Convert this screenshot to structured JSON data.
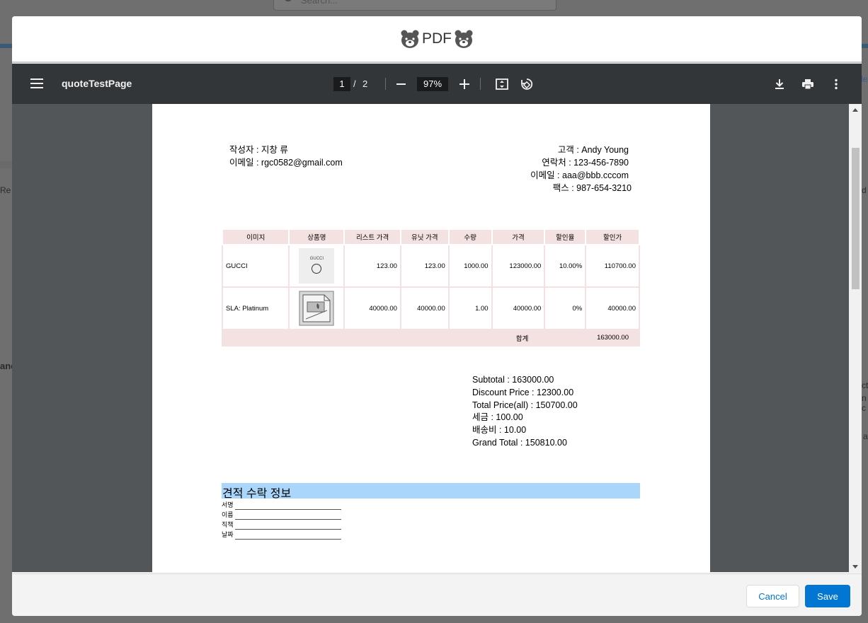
{
  "background": {
    "search_placeholder": "Search...",
    "left_fragment_1": "Re",
    "left_fragment_2": "anc",
    "right_fragment_1": "ct",
    "right_fragment_2": "n c",
    "right_fragment_3": "a",
    "right_fragment_4": "d",
    "right_fragment_5": "le"
  },
  "header": {
    "logo_text": "PDF",
    "logo_icon": "bear-icon"
  },
  "viewer": {
    "title": "quoteTestPage",
    "current_page": "1",
    "page_separator": "/",
    "total_pages": "2",
    "zoom": "97%",
    "icons": [
      "menu-icon",
      "zoom-out-icon",
      "zoom-in-icon",
      "fit-page-icon",
      "rotate-icon",
      "download-icon",
      "print-icon",
      "more-options-icon"
    ]
  },
  "document": {
    "author_line": "작성자 : 지창 류",
    "author_email": "이메일 : rgc0582@gmail.com",
    "customer_line": "고객 : Andy Young",
    "contact_line": "연락처 : 123-456-7890",
    "customer_email": "이메일 : aaa@bbb.cccom",
    "fax_line": "팩스 : 987-654-3210",
    "table": {
      "headers": [
        "이미지",
        "상품명",
        "리스트 가격",
        "유닛 가격",
        "수량",
        "가격",
        "할인율",
        "할인가"
      ],
      "rows": [
        {
          "name": "GUCCI",
          "image_label": "GUCCI",
          "list_price": "123.00",
          "unit_price": "123.00",
          "quantity": "1000.00",
          "price": "123000.00",
          "discount_rate": "10.00%",
          "discounted": "110700.00"
        },
        {
          "name": "SLA: Platinum",
          "image_label": "",
          "list_price": "40000.00",
          "unit_price": "40000.00",
          "quantity": "1.00",
          "price": "40000.00",
          "discount_rate": "0%",
          "discounted": "40000.00"
        }
      ],
      "sum_label": "합계",
      "sum_value": "163000.00"
    },
    "totals": {
      "subtotal": "Subtotal : 163000.00",
      "discount": "Discount Price : 12300.00",
      "total_price": "Total Price(all) : 150700.00",
      "tax": "세금 : 100.00",
      "shipping": "배송비 : 10.00",
      "grand_total": "Grand Total : 150810.00"
    },
    "accept": {
      "title": "견적 수락 정보",
      "sign": "서명",
      "name": "이름",
      "position": "직책",
      "date": "날짜"
    }
  },
  "footer": {
    "cancel_label": "Cancel",
    "save_label": "Save"
  },
  "colors": {
    "toolbar": "#323639",
    "viewer_bg": "#525659",
    "table_header": "#f4e1e1",
    "accept_bar": "#aad6fb",
    "save_button": "#0176d3"
  }
}
